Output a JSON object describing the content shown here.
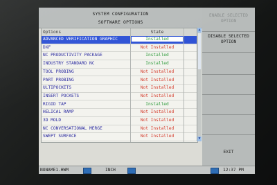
{
  "header": {
    "title": "SYSTEM CONFIGURATION",
    "subtitle": "SOFTWARE OPTIONS"
  },
  "table": {
    "columns": [
      "Options",
      "State"
    ],
    "rows": [
      {
        "option": "ADVANCED VERIFICATION GRAPHIC",
        "state": "Installed",
        "selected": true
      },
      {
        "option": "DXF",
        "state": "Not Installed"
      },
      {
        "option": "NC PRODUCTIVITY PACKAGE",
        "state": "Installed"
      },
      {
        "option": "INDUSTRY STANDARD NC",
        "state": "Installed"
      },
      {
        "option": "TOOL PROBING",
        "state": "Not Installed"
      },
      {
        "option": "PART PROBING",
        "state": "Not Installed"
      },
      {
        "option": "ULTIPOCKETS",
        "state": "Not Installed"
      },
      {
        "option": "INSERT POCKETS",
        "state": "Not Installed"
      },
      {
        "option": "RIGID TAP",
        "state": "Installed"
      },
      {
        "option": "HELICAL RAMP",
        "state": "Not Installed"
      },
      {
        "option": "3D MOLD",
        "state": "Not Installed"
      },
      {
        "option": "NC CONVERSATIONAL MERGE",
        "state": "Not Installed"
      },
      {
        "option": "SWEPT SURFACE",
        "state": "Not Installed"
      }
    ]
  },
  "softkeys": {
    "enable": [
      "ENABLE SELECTED",
      "OPTION"
    ],
    "disable": [
      "DISABLE SELECTED",
      "OPTION"
    ],
    "exit": "EXIT"
  },
  "status": {
    "filename": "NONAME1.HWM",
    "units": "INCH",
    "time": "12:37 PM"
  },
  "colors": {
    "installed": "#2e9a3a",
    "not_installed": "#d43b2b",
    "selection": "#2f53d6"
  }
}
